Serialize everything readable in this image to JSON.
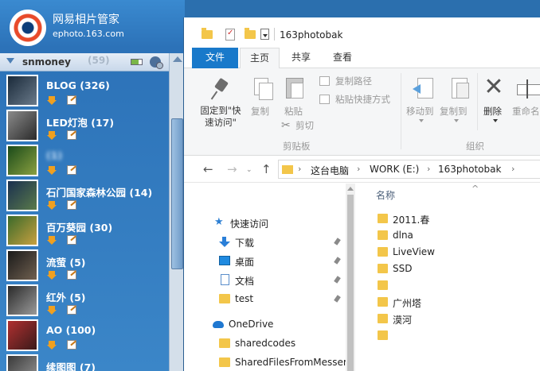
{
  "app": {
    "title": "网易相片管家",
    "subtitle": "ephoto.163.com",
    "user": {
      "name": "snmoney",
      "ghost_count": "(59)"
    },
    "albums": [
      {
        "label": "BLOG (326)",
        "colors": [
          "#1a2a3a",
          "#6a7a8a"
        ],
        "blurred": false
      },
      {
        "label": "LED灯泡 (17)",
        "colors": [
          "#8a8a8a",
          "#2a2a2a"
        ],
        "blurred": false
      },
      {
        "label": "(1)",
        "colors": [
          "#1a4a1a",
          "#8aa040"
        ],
        "blurred": true
      },
      {
        "label": "石门国家森林公园 (14)",
        "colors": [
          "#1a3050",
          "#5a7a4a"
        ],
        "blurred": false
      },
      {
        "label": "百万葵园 (30)",
        "colors": [
          "#3a6a2a",
          "#c8a040"
        ],
        "blurred": false
      },
      {
        "label": "流萤 (5)",
        "colors": [
          "#1a1a1a",
          "#706050"
        ],
        "blurred": false
      },
      {
        "label": "红外 (5)",
        "colors": [
          "#2a2a2a",
          "#9a9a9a"
        ],
        "blurred": false
      },
      {
        "label": "AO (100)",
        "colors": [
          "#b03030",
          "#3a1a1a"
        ],
        "blurred": false
      },
      {
        "label": "续图图 (7)",
        "colors": [
          "#3a3a3a",
          "#999999"
        ],
        "blurred": false
      }
    ]
  },
  "explorer": {
    "window_title": "163photobak",
    "tabs": [
      "文件",
      "主页",
      "共享",
      "查看"
    ],
    "ribbon": {
      "pin_label": "固定到\"快\n速访问\"",
      "copy_label": "复制",
      "paste_label": "粘贴",
      "copy_path_label": "复制路径",
      "paste_shortcut_label": "粘贴快捷方式",
      "cut_label": "剪切",
      "clipboard_group": "剪贴板",
      "move_to_label": "移动到",
      "copy_to_label": "复制到",
      "delete_label": "删除",
      "rename_label": "重命名",
      "organize_group": "组织"
    },
    "address": {
      "parts": [
        "这台电脑",
        "WORK (E:)",
        "163photobak"
      ]
    },
    "nav_items": [
      {
        "label": "快速访问",
        "icon": "star-icon",
        "pinned": false
      },
      {
        "label": "下载",
        "icon": "download-icon",
        "pinned": true
      },
      {
        "label": "桌面",
        "icon": "desktop-icon",
        "pinned": true
      },
      {
        "label": "文档",
        "icon": "document-icon",
        "pinned": true
      },
      {
        "label": "test",
        "icon": "folder-icon",
        "pinned": true
      },
      {
        "label": "OneDrive",
        "icon": "cloud-icon",
        "pinned": false
      },
      {
        "label": "sharedcodes",
        "icon": "folder-icon",
        "pinned": false
      },
      {
        "label": "SharedFilesFromMesser",
        "icon": "folder-icon",
        "pinned": false
      },
      {
        "label": "",
        "icon": "folder-icon",
        "pinned": false,
        "blurred": true
      }
    ],
    "content": {
      "column_name": "名称",
      "files": [
        {
          "label": "2011.春",
          "blurred": false
        },
        {
          "label": "dlna",
          "blurred": false
        },
        {
          "label": "LiveView",
          "blurred": false
        },
        {
          "label": "SSD",
          "blurred": false
        },
        {
          "label": "",
          "blurred": true
        },
        {
          "label": "广州塔",
          "blurred": false
        },
        {
          "label": "漠河",
          "blurred": false
        },
        {
          "label": "",
          "blurred": true
        }
      ]
    }
  }
}
